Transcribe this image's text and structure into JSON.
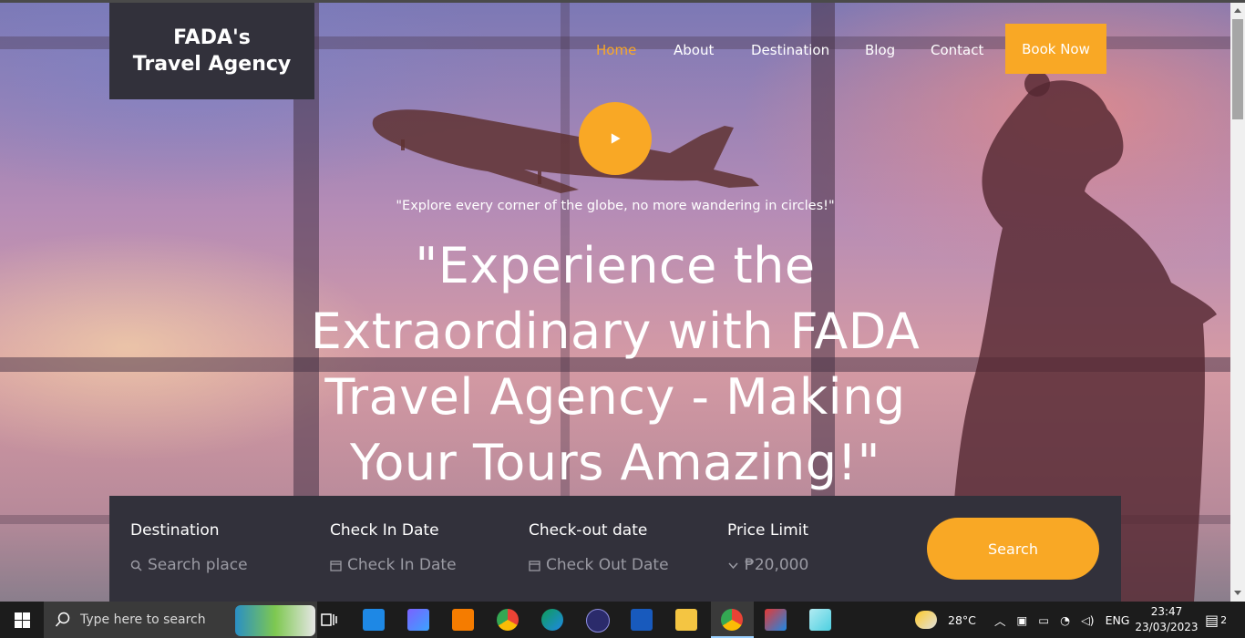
{
  "brand": {
    "line1": "FADA's",
    "line2": "Travel Agency"
  },
  "nav": {
    "home": "Home",
    "about": "About",
    "destination": "Destination",
    "blog": "Blog",
    "contact": "Contact",
    "book_now": "Book Now"
  },
  "hero": {
    "tagline": "\"Explore every corner of the globe, no more wandering in circles!\"",
    "headline": "\"Experience the Extraordinary with FADA Travel Agency - Making Your Tours Amazing!\""
  },
  "search_panel": {
    "destination": {
      "label": "Destination",
      "placeholder": "Search place",
      "icon": "search-icon"
    },
    "check_in": {
      "label": "Check In Date",
      "placeholder": "Check In Date",
      "icon": "calendar-icon"
    },
    "check_out": {
      "label": "Check-out date",
      "placeholder": "Check Out Date",
      "icon": "calendar-icon"
    },
    "price": {
      "label": "Price Limit",
      "value": "₱20,000",
      "icon": "chevron-down-icon"
    },
    "search_button": "Search"
  },
  "taskbar": {
    "search_placeholder": "Type here to search",
    "weather": "28°C",
    "language": "ENG",
    "time": "23:47",
    "date": "23/03/2023",
    "notifications": "2"
  },
  "colors": {
    "accent": "#f9a825",
    "panel": "#32313b",
    "taskbar": "#1c1c1c"
  }
}
